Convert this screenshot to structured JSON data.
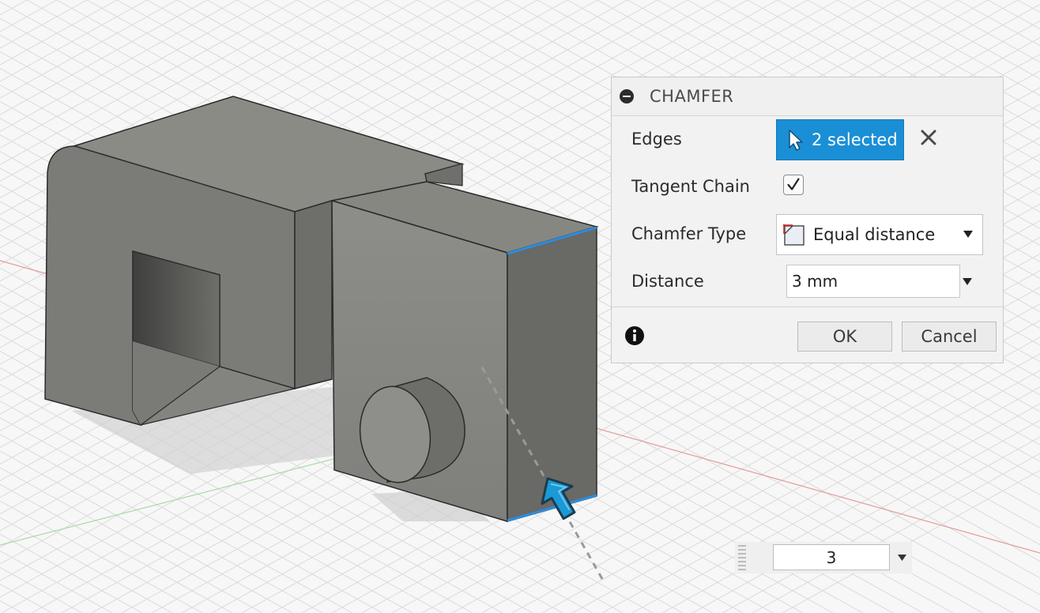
{
  "dialog": {
    "title": "CHAMFER",
    "edges_label": "Edges",
    "edges_selection": "2 selected",
    "tangent_chain_label": "Tangent Chain",
    "tangent_chain_checked": true,
    "chamfer_type_label": "Chamfer Type",
    "chamfer_type_value": "Equal distance",
    "distance_label": "Distance",
    "distance_value": "3 mm",
    "ok_label": "OK",
    "cancel_label": "Cancel",
    "accent_color": "#1a8fd6"
  },
  "viewport": {
    "manipulator_value": "3",
    "model_color": "#8f8f8a",
    "selected_edge_color": "#2b8de0",
    "grid_color": "#d9d9d9",
    "x_axis_color": "#e07a7a",
    "y_axis_color": "#8fd18f"
  },
  "icons": [
    "collapse-icon",
    "cursor-arrow-icon",
    "clear-x-icon",
    "checkmark-icon",
    "equal-distance-icon",
    "caret-down-icon",
    "info-icon",
    "drag-arrow-icon",
    "grip-icon"
  ]
}
